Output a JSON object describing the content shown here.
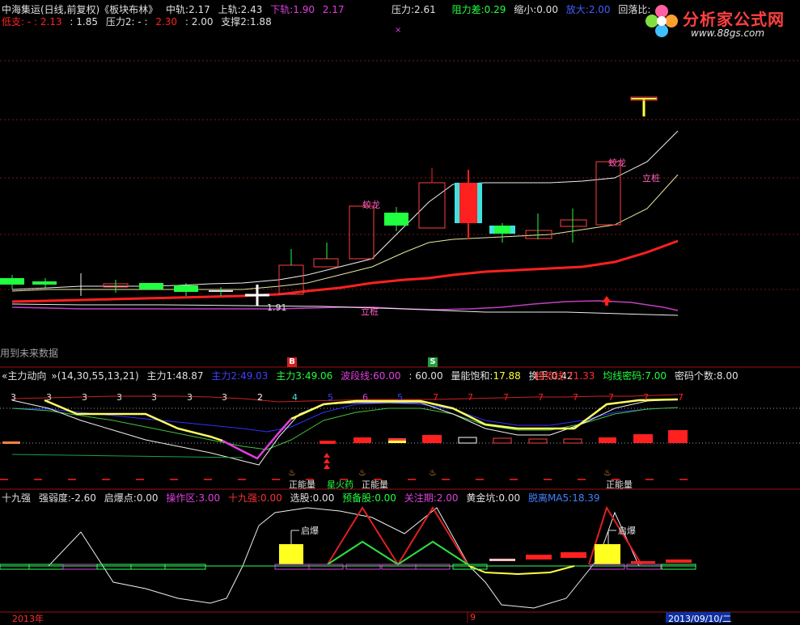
{
  "main_header": {
    "title": "中海集运(日线,前复权)《板块布林》",
    "mid_label": "中轨:",
    "mid_value": "2.17",
    "upper_label": "上轨:",
    "upper_value": "2.43",
    "lower_label": "下轨:",
    "lower_value": "1.90",
    "extra_value": "2.17",
    "pressure_label": "压力:",
    "pressure_value": "2.61",
    "resist_label": "阻力差:",
    "resist_value": "0.29",
    "shrink_label": "缩小:",
    "shrink_value": "0.00",
    "enlarge_label": "放大:",
    "enlarge_value": "2.00",
    "retrace_label": "回落比:",
    "row2_support_low": "低支:",
    "row2_v1": "2.13",
    "row2_v2": "1.85",
    "row2_pressure2": "压力2:",
    "row2_v3": "2.30",
    "row2_v4": "2.00",
    "row2_support2": "支撑2:",
    "row2_v5": "1.88"
  },
  "logo": {
    "title": "分析家公式网",
    "url": "www.88gs.com"
  },
  "main_chart": {
    "labels": {
      "dragon1": "蛟龙",
      "dragon2": "蛟龙",
      "pile1": "立桩",
      "pile2": "立桩",
      "low_price": "1.91",
      "future_note": "用到未来数据"
    },
    "markers": {
      "b": "B",
      "s": "S"
    }
  },
  "pane2_header": {
    "title": "主力动向",
    "params": "(14,30,55,13,21)",
    "main1_label": "主力1:",
    "main1_value": "48.87",
    "main2_label": "主力2:",
    "main2_value": "49.03",
    "main3_label": "主力3:",
    "main3_value": "49.06",
    "wave_label": "波段线:",
    "wave_value": "60.00",
    "v60": "60.00",
    "saturation_label": "量能饱和:",
    "saturation_value": "17.88",
    "turnover_label": "换手:",
    "turnover_value": "0.42",
    "trend_label": "趋势线:",
    "trend_value": "71.33",
    "code_label": "均线密码:",
    "code_value": "7.00",
    "count_label": "密码个数:",
    "count_value": "8.00"
  },
  "pane2_labels": {
    "digits": [
      "3",
      "3",
      "3",
      "3",
      "3",
      "3",
      "3",
      "2",
      "4",
      "5",
      "6",
      "5",
      "7",
      "7",
      "7",
      "7",
      "7",
      "7",
      "7",
      "7"
    ],
    "positive1": "正能量",
    "fire": "星火药",
    "positive2": "正能量",
    "positive3": "正能量"
  },
  "pane3_header": {
    "title": "十九强",
    "weak_label": "强弱度:",
    "weak_value": "-2.60",
    "start_label": "启爆点:",
    "start_value": "0.00",
    "op_label": "操作区:",
    "op_value": "3.00",
    "n19_label": "十九强:",
    "n19_value": "0.00",
    "pick_label": "选股:",
    "pick_value": "0.00",
    "prep_label": "预备股:",
    "prep_value": "0.00",
    "watch_label": "关注期:",
    "watch_value": "2.00",
    "gold_label": "黄金坑:",
    "gold_value": "0.00",
    "ma5_label": "脱离MA5:",
    "ma5_value": "18.39"
  },
  "pane3_labels": {
    "burst1": "启爆",
    "burst2": "启爆"
  },
  "footer": {
    "year": "2013年",
    "mid": "9",
    "date": "2013/09/10/二"
  },
  "colors": {
    "bg": "#000000",
    "red": "#ff2020",
    "green": "#20ff40",
    "cyan": "#40e0e0",
    "yellow": "#ffff40",
    "magenta": "#e040e0",
    "blue": "#4040ff",
    "white": "#f0f0f0"
  }
}
